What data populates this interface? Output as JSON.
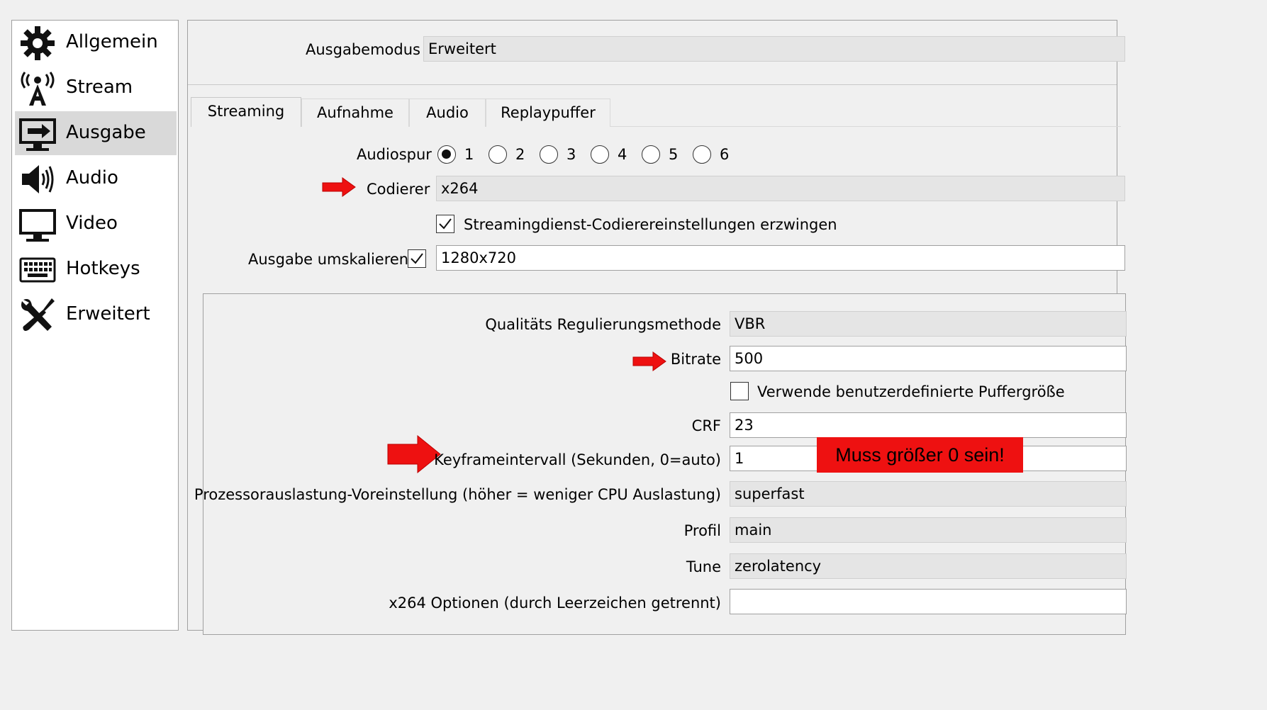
{
  "sidebar": {
    "items": [
      {
        "label": "Allgemein",
        "icon": "gear-icon"
      },
      {
        "label": "Stream",
        "icon": "broadcast-antenna-icon"
      },
      {
        "label": "Ausgabe",
        "icon": "monitor-output-icon",
        "selected": true
      },
      {
        "label": "Audio",
        "icon": "speaker-icon"
      },
      {
        "label": "Video",
        "icon": "monitor-icon"
      },
      {
        "label": "Hotkeys",
        "icon": "keyboard-icon"
      },
      {
        "label": "Erweitert",
        "icon": "tools-icon"
      }
    ]
  },
  "output_mode": {
    "label": "Ausgabemodus",
    "value": "Erweitert"
  },
  "tabs": [
    {
      "label": "Streaming",
      "active": true
    },
    {
      "label": "Aufnahme"
    },
    {
      "label": "Audio"
    },
    {
      "label": "Replaypuffer"
    }
  ],
  "audio_track": {
    "label": "Audiospur",
    "options": [
      "1",
      "2",
      "3",
      "4",
      "5",
      "6"
    ],
    "selected": "1"
  },
  "encoder": {
    "label": "Codierer",
    "value": "x264"
  },
  "enforce_encoder": {
    "label": "Streamingdienst-Codierereinstellungen erzwingen",
    "checked": true
  },
  "rescale": {
    "label": "Ausgabe umskalieren",
    "checked": true,
    "value": "1280x720"
  },
  "rate_control": {
    "label": "Qualitäts Regulierungsmethode",
    "value": "VBR"
  },
  "bitrate": {
    "label": "Bitrate",
    "value": "500"
  },
  "custom_buffer": {
    "label": "Verwende benutzerdefinierte Puffergröße",
    "checked": false
  },
  "crf": {
    "label": "CRF",
    "value": "23"
  },
  "keyframe": {
    "label": "Keyframeintervall (Sekunden, 0=auto)",
    "value": "1"
  },
  "cpu_preset": {
    "label": "Prozessorauslastung-Voreinstellung (höher = weniger CPU Auslastung)",
    "value": "superfast"
  },
  "profile": {
    "label": "Profil",
    "value": "main"
  },
  "tune": {
    "label": "Tune",
    "value": "zerolatency"
  },
  "x264_options": {
    "label": "x264 Optionen (durch Leerzeichen getrennt)",
    "value": ""
  },
  "annotation": {
    "text": "Muss größer 0 sein!",
    "color": "#ee1111"
  },
  "colors": {
    "arrow": "#ee1111",
    "selected_bg": "#d9d9d9",
    "window_bg": "#f0f0f0"
  }
}
